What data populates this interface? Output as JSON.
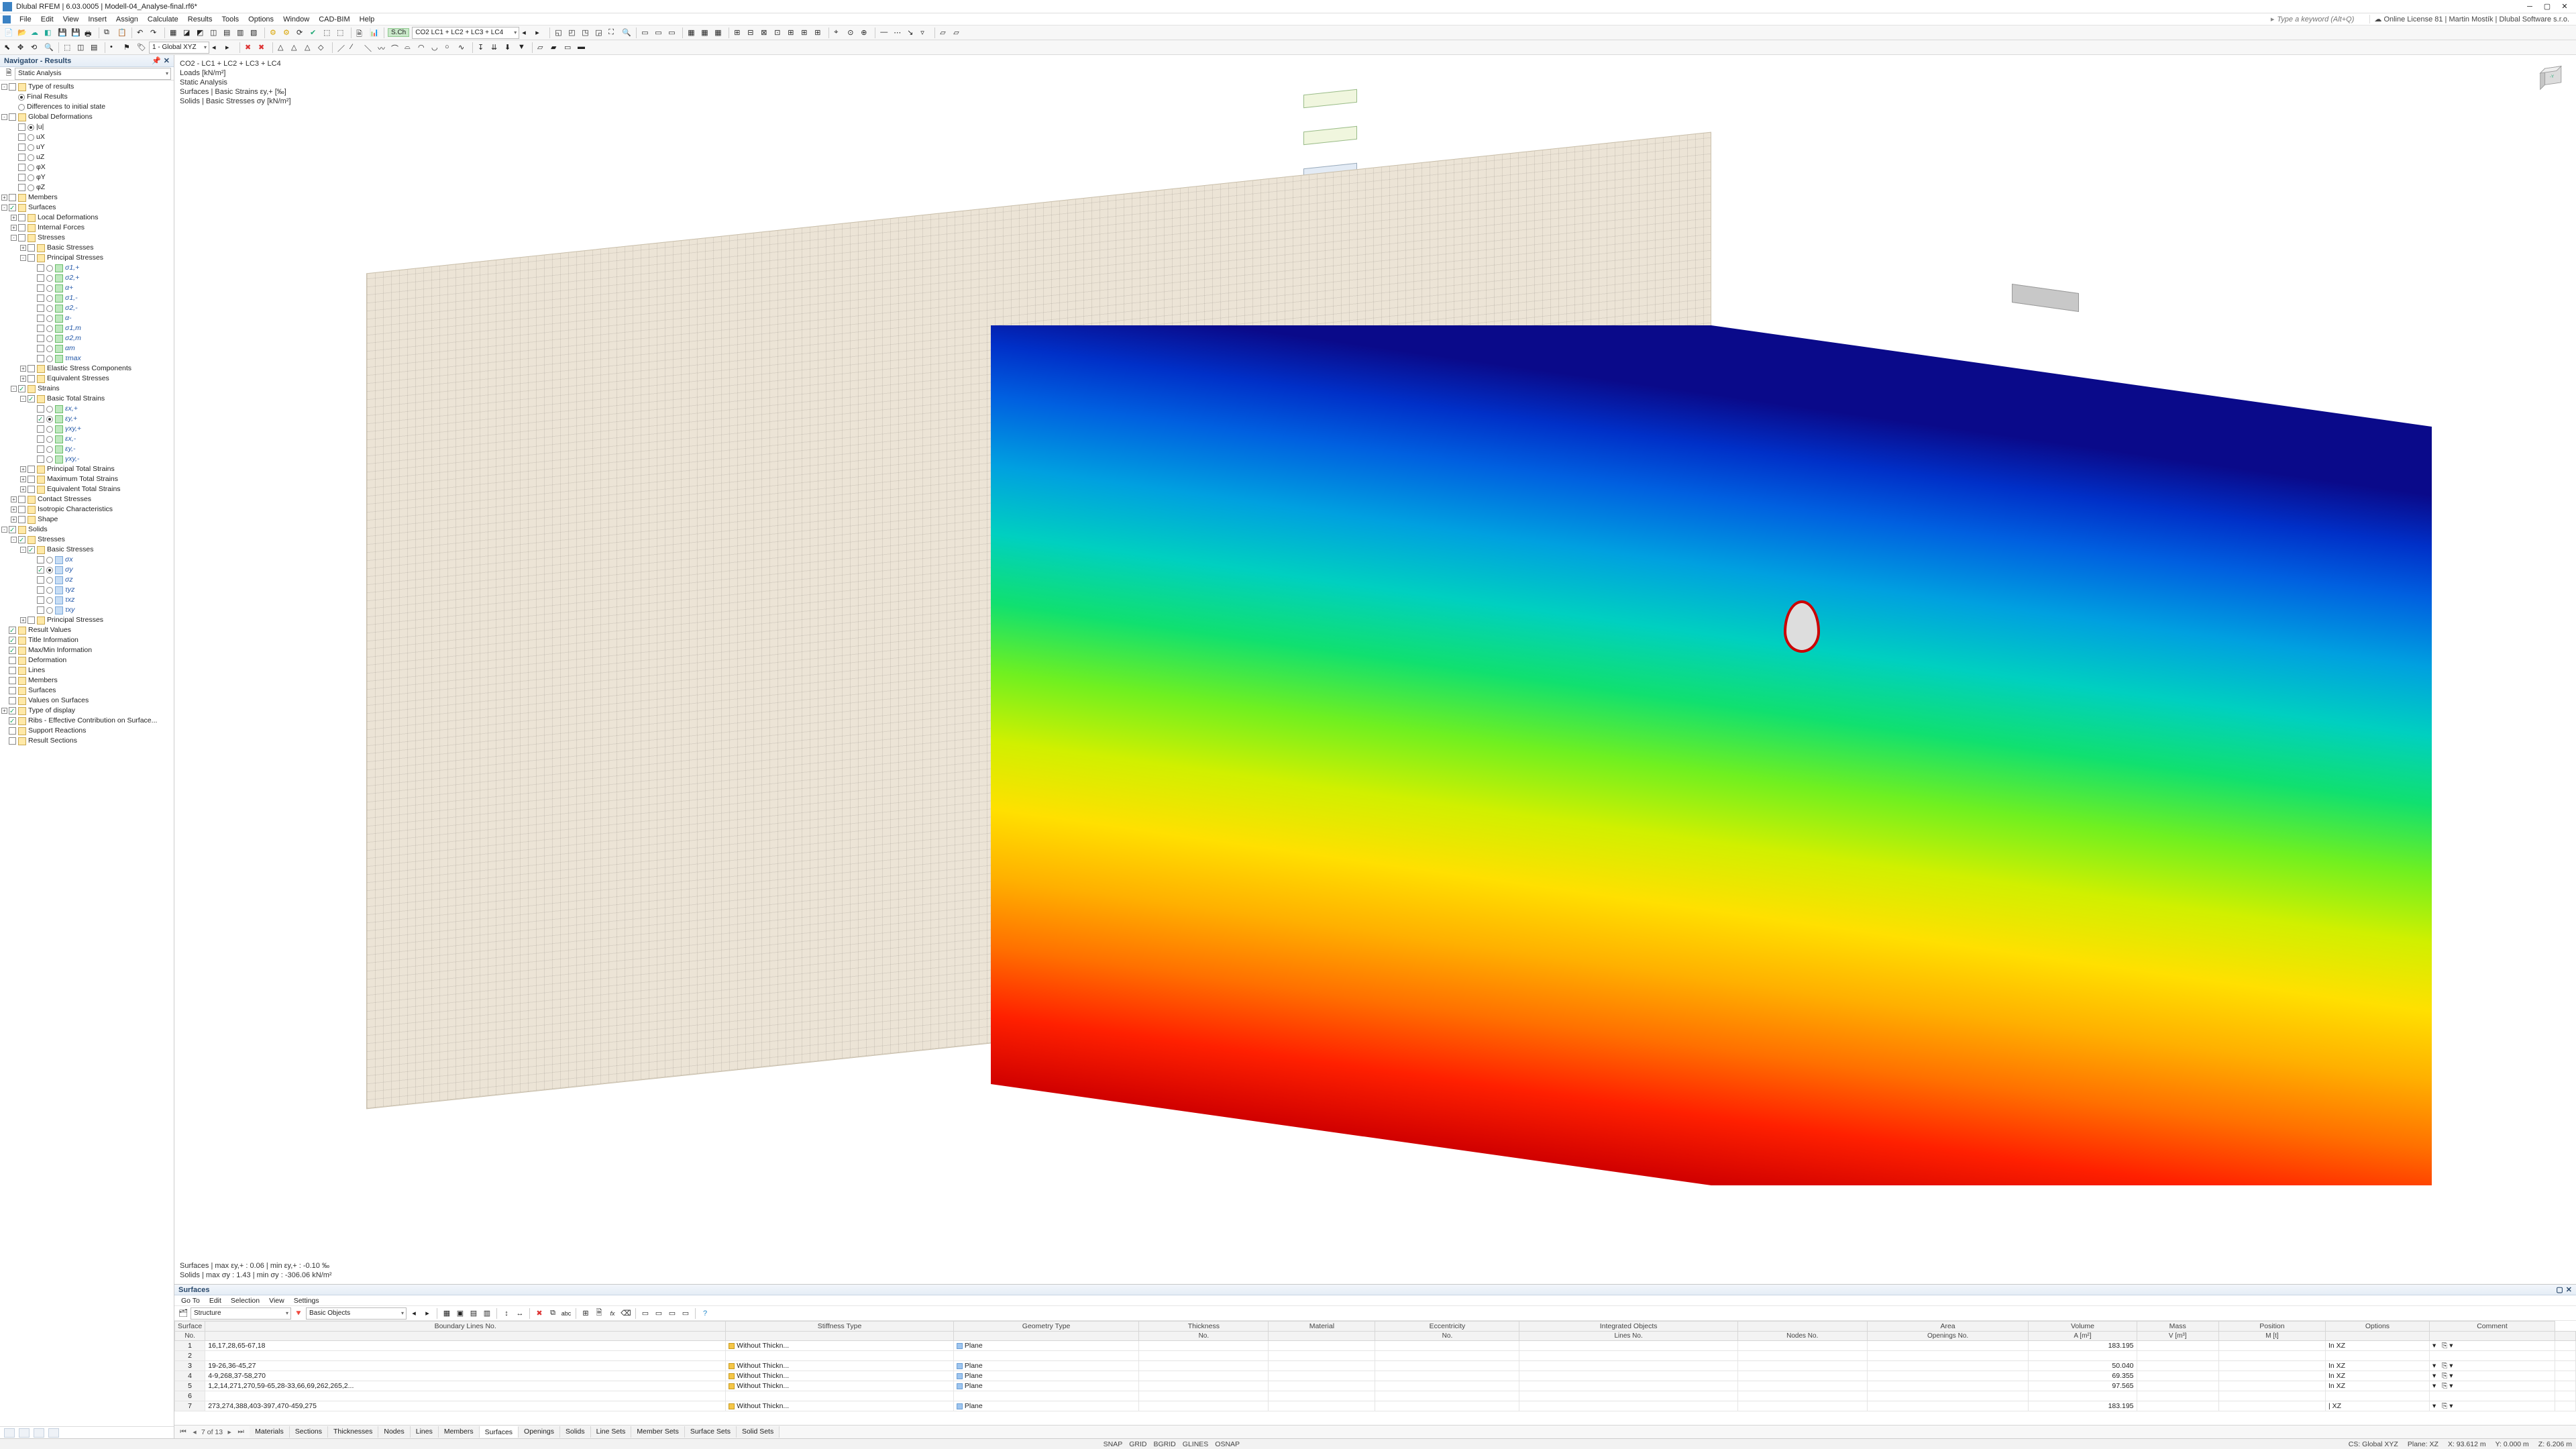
{
  "title": "Dlubal RFEM | 6.03.0005 | Modell-04_Analyse-final.rf6*",
  "license": "Online License 81 | Martin Mostík | Dlubal Software s.r.o.",
  "search_placeholder": "Type a keyword (Alt+Q)",
  "menus": [
    "File",
    "Edit",
    "View",
    "Insert",
    "Assign",
    "Calculate",
    "Results",
    "Tools",
    "Options",
    "Window",
    "CAD-BIM",
    "Help"
  ],
  "tb1_combo_prefix": "S.Ch",
  "tb1_combo": "CO2   LC1 + LC2 + LC3 + LC4",
  "tb2_combo": "1 - Global XYZ",
  "navigator": {
    "title": "Navigator - Results",
    "mode": "Static Analysis",
    "tree": [
      {
        "d": 0,
        "tog": "-",
        "chk": false,
        "ic": "folder",
        "lbl": "Type of results"
      },
      {
        "d": 1,
        "rad": true,
        "lbl": "Final Results"
      },
      {
        "d": 1,
        "rad": false,
        "lbl": "Differences to initial state"
      },
      {
        "d": 0,
        "tog": "-",
        "chk": false,
        "ic": "folder",
        "lbl": "Global Deformations"
      },
      {
        "d": 1,
        "rad": true,
        "chk": false,
        "lbl": "|u|"
      },
      {
        "d": 1,
        "rad": false,
        "chk": false,
        "lbl": "uX"
      },
      {
        "d": 1,
        "rad": false,
        "chk": false,
        "lbl": "uY"
      },
      {
        "d": 1,
        "rad": false,
        "chk": false,
        "lbl": "uZ"
      },
      {
        "d": 1,
        "rad": false,
        "chk": false,
        "lbl": "φX"
      },
      {
        "d": 1,
        "rad": false,
        "chk": false,
        "lbl": "φY"
      },
      {
        "d": 1,
        "rad": false,
        "chk": false,
        "lbl": "φZ"
      },
      {
        "d": 0,
        "tog": "+",
        "chk": false,
        "ic": "folder",
        "lbl": "Members"
      },
      {
        "d": 0,
        "tog": "-",
        "chk": true,
        "ic": "folder",
        "lbl": "Surfaces"
      },
      {
        "d": 1,
        "tog": "+",
        "chk": false,
        "ic": "folder",
        "lbl": "Local Deformations"
      },
      {
        "d": 1,
        "tog": "+",
        "chk": false,
        "ic": "folder",
        "lbl": "Internal Forces"
      },
      {
        "d": 1,
        "tog": "-",
        "chk": false,
        "ic": "folder",
        "lbl": "Stresses"
      },
      {
        "d": 2,
        "tog": "+",
        "chk": false,
        "ic": "folder",
        "lbl": "Basic Stresses"
      },
      {
        "d": 2,
        "tog": "-",
        "chk": false,
        "ic": "folder",
        "lbl": "Principal Stresses"
      },
      {
        "d": 3,
        "rad": false,
        "chk": false,
        "ic": "grn",
        "lbl": "σ1,+",
        "em": true
      },
      {
        "d": 3,
        "rad": false,
        "chk": false,
        "ic": "grn",
        "lbl": "σ2,+",
        "em": true
      },
      {
        "d": 3,
        "rad": false,
        "chk": false,
        "ic": "grn",
        "lbl": "α+",
        "em": true
      },
      {
        "d": 3,
        "rad": false,
        "chk": false,
        "ic": "grn",
        "lbl": "σ1,-",
        "em": true
      },
      {
        "d": 3,
        "rad": false,
        "chk": false,
        "ic": "grn",
        "lbl": "σ2,-",
        "em": true
      },
      {
        "d": 3,
        "rad": false,
        "chk": false,
        "ic": "grn",
        "lbl": "α-",
        "em": true
      },
      {
        "d": 3,
        "rad": false,
        "chk": false,
        "ic": "grn",
        "lbl": "σ1,m",
        "em": true
      },
      {
        "d": 3,
        "rad": false,
        "chk": false,
        "ic": "grn",
        "lbl": "σ2,m",
        "em": true
      },
      {
        "d": 3,
        "rad": false,
        "chk": false,
        "ic": "grn",
        "lbl": "αm",
        "em": true
      },
      {
        "d": 3,
        "rad": false,
        "chk": false,
        "ic": "grn",
        "lbl": "τmax",
        "em": true
      },
      {
        "d": 2,
        "tog": "+",
        "chk": false,
        "ic": "folder",
        "lbl": "Elastic Stress Components"
      },
      {
        "d": 2,
        "tog": "+",
        "chk": false,
        "ic": "folder",
        "lbl": "Equivalent Stresses"
      },
      {
        "d": 1,
        "tog": "-",
        "chk": true,
        "ic": "folder",
        "lbl": "Strains"
      },
      {
        "d": 2,
        "tog": "-",
        "chk": true,
        "ic": "folder",
        "lbl": "Basic Total Strains"
      },
      {
        "d": 3,
        "rad": false,
        "chk": false,
        "ic": "grn",
        "lbl": "εx,+",
        "em": true
      },
      {
        "d": 3,
        "rad": true,
        "chk": true,
        "ic": "grn",
        "lbl": "εy,+",
        "em": true
      },
      {
        "d": 3,
        "rad": false,
        "chk": false,
        "ic": "grn",
        "lbl": "γxy,+",
        "em": true
      },
      {
        "d": 3,
        "rad": false,
        "chk": false,
        "ic": "grn",
        "lbl": "εx,-",
        "em": true
      },
      {
        "d": 3,
        "rad": false,
        "chk": false,
        "ic": "grn",
        "lbl": "εy,-",
        "em": true
      },
      {
        "d": 3,
        "rad": false,
        "chk": false,
        "ic": "grn",
        "lbl": "γxy,-",
        "em": true
      },
      {
        "d": 2,
        "tog": "+",
        "chk": false,
        "ic": "folder",
        "lbl": "Principal Total Strains"
      },
      {
        "d": 2,
        "tog": "+",
        "chk": false,
        "ic": "folder",
        "lbl": "Maximum Total Strains"
      },
      {
        "d": 2,
        "tog": "+",
        "chk": false,
        "ic": "folder",
        "lbl": "Equivalent Total Strains"
      },
      {
        "d": 1,
        "tog": "+",
        "chk": false,
        "ic": "folder",
        "lbl": "Contact Stresses"
      },
      {
        "d": 1,
        "tog": "+",
        "chk": false,
        "ic": "folder",
        "lbl": "Isotropic Characteristics"
      },
      {
        "d": 1,
        "tog": "+",
        "chk": false,
        "ic": "folder",
        "lbl": "Shape"
      },
      {
        "d": 0,
        "tog": "-",
        "chk": true,
        "ic": "folder",
        "lbl": "Solids"
      },
      {
        "d": 1,
        "tog": "-",
        "chk": true,
        "ic": "folder",
        "lbl": "Stresses"
      },
      {
        "d": 2,
        "tog": "-",
        "chk": true,
        "ic": "folder",
        "lbl": "Basic Stresses"
      },
      {
        "d": 3,
        "rad": false,
        "chk": false,
        "ic": "blu",
        "lbl": "σx",
        "em": true
      },
      {
        "d": 3,
        "rad": true,
        "chk": true,
        "ic": "blu",
        "lbl": "σy",
        "em": true
      },
      {
        "d": 3,
        "rad": false,
        "chk": false,
        "ic": "blu",
        "lbl": "σz",
        "em": true
      },
      {
        "d": 3,
        "rad": false,
        "chk": false,
        "ic": "blu",
        "lbl": "τyz",
        "em": true
      },
      {
        "d": 3,
        "rad": false,
        "chk": false,
        "ic": "blu",
        "lbl": "τxz",
        "em": true
      },
      {
        "d": 3,
        "rad": false,
        "chk": false,
        "ic": "blu",
        "lbl": "τxy",
        "em": true
      },
      {
        "d": 2,
        "tog": "+",
        "chk": false,
        "ic": "folder",
        "lbl": "Principal Stresses"
      },
      {
        "d": 0,
        "chk": true,
        "ic": "folder",
        "lbl": "Result Values"
      },
      {
        "d": 0,
        "chk": true,
        "ic": "folder",
        "lbl": "Title Information"
      },
      {
        "d": 0,
        "chk": true,
        "ic": "folder",
        "lbl": "Max/Min Information"
      },
      {
        "d": 0,
        "chk": false,
        "ic": "folder",
        "lbl": "Deformation"
      },
      {
        "d": 0,
        "chk": false,
        "ic": "folder",
        "lbl": "Lines"
      },
      {
        "d": 0,
        "chk": false,
        "ic": "folder",
        "lbl": "Members"
      },
      {
        "d": 0,
        "chk": false,
        "ic": "folder",
        "lbl": "Surfaces"
      },
      {
        "d": 0,
        "chk": false,
        "ic": "folder",
        "lbl": "Values on Surfaces"
      },
      {
        "d": 0,
        "tog": "+",
        "chk": true,
        "ic": "folder",
        "lbl": "Type of display"
      },
      {
        "d": 0,
        "chk": true,
        "ic": "folder",
        "lbl": "Ribs - Effective Contribution on Surface..."
      },
      {
        "d": 0,
        "chk": false,
        "ic": "folder",
        "lbl": "Support Reactions"
      },
      {
        "d": 0,
        "chk": false,
        "ic": "folder",
        "lbl": "Result Sections"
      }
    ]
  },
  "overlay": {
    "l1": "CO2 - LC1 + LC2 + LC3 + LC4",
    "l2": "Loads [kN/m²]",
    "l3": "Static Analysis",
    "l4": "Surfaces | Basic Strains εy,+ [‰]",
    "l5": "Solids | Basic Stresses σy [kN/m²]",
    "b1": "Surfaces | max εy,+ : 0.06 | min εy,+ : -0.10 ‰",
    "b2": "Solids | max σy : 1.43 | min σy : -306.06 kN/m²"
  },
  "datapanel": {
    "title": "Surfaces",
    "menus": [
      "Go To",
      "Edit",
      "Selection",
      "View",
      "Settings"
    ],
    "combo1": "Structure",
    "combo2": "Basic Objects",
    "pager": "7 of 13",
    "tabs": [
      "Materials",
      "Sections",
      "Thicknesses",
      "Nodes",
      "Lines",
      "Members",
      "Surfaces",
      "Openings",
      "Solids",
      "Line Sets",
      "Member Sets",
      "Surface Sets",
      "Solid Sets"
    ],
    "active_tab": "Surfaces",
    "cols_top": [
      "Surface",
      "Boundary Lines No.",
      "Stiffness Type",
      "Geometry Type",
      "Thickness",
      "Material",
      "Eccentricity",
      "Integrated Objects",
      "",
      "Area",
      "Volume",
      "Mass",
      "Position",
      "Options",
      "Comment"
    ],
    "cols_sub": [
      "No.",
      "",
      "",
      "",
      "No.",
      "",
      "No.",
      "Lines No.",
      "Nodes No.",
      "Openings No.",
      "A [m²]",
      "V [m³]",
      "M [t]",
      "",
      "",
      ""
    ],
    "rows": [
      {
        "no": "1",
        "bl": "16,17,28,65-67,18",
        "st": "Without Thickn...",
        "gt": "Plane",
        "area": "183.195",
        "pos": "In XZ"
      },
      {
        "no": "2"
      },
      {
        "no": "3",
        "bl": "19-26,36-45,27",
        "st": "Without Thickn...",
        "gt": "Plane",
        "area": "50.040",
        "pos": "In XZ"
      },
      {
        "no": "4",
        "bl": "4-9,268,37-58,270",
        "st": "Without Thickn...",
        "gt": "Plane",
        "area": "69.355",
        "pos": "In XZ"
      },
      {
        "no": "5",
        "bl": "1,2,14,271,270,59-65,28-33,66,69,262,265,2...",
        "st": "Without Thickn...",
        "gt": "Plane",
        "area": "97.565",
        "pos": "In XZ"
      },
      {
        "no": "6"
      },
      {
        "no": "7",
        "bl": "273,274,388,403-397,470-459,275",
        "st": "Without Thickn...",
        "gt": "Plane",
        "area": "183.195",
        "pos": "| XZ"
      }
    ]
  },
  "status": {
    "snaps": [
      "SNAP",
      "GRID",
      "BGRID",
      "GLINES",
      "OSNAP"
    ],
    "cs": "CS: Global XYZ",
    "plane": "Plane: XZ",
    "x": "X: 93.612 m",
    "y": "Y: 0.000 m",
    "z": "Z: 6.206 m"
  }
}
